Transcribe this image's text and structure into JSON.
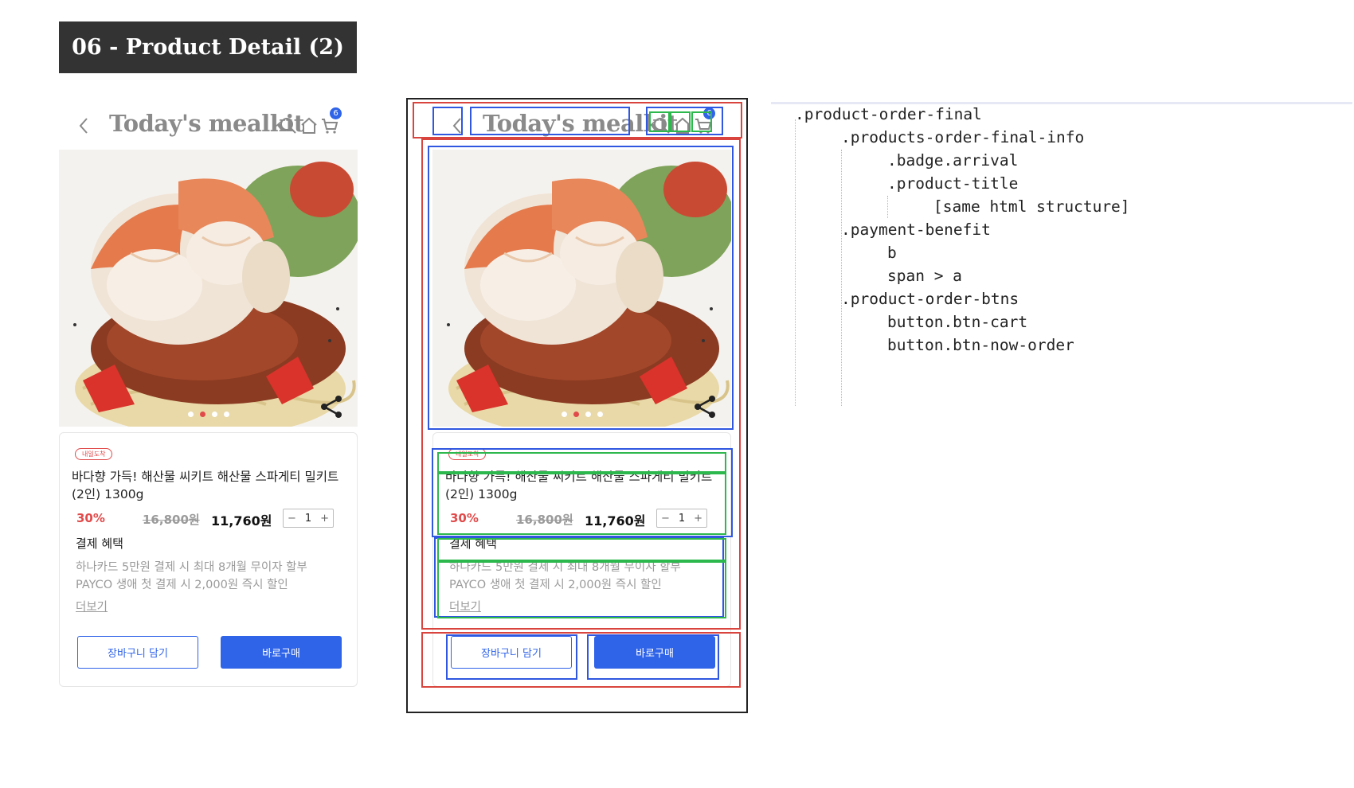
{
  "slide_title": "06 - Product Detail (2)",
  "header": {
    "brand": "Today's mealkit",
    "cart_count": "6"
  },
  "icons": {
    "back": "chevron-left-icon",
    "search": "search-icon",
    "home": "home-icon",
    "cart": "cart-icon",
    "share": "share-icon"
  },
  "carousel": {
    "slides": 4,
    "active": 1
  },
  "product": {
    "badge": "내일도착",
    "title": "바다향 가득! 해산물 씨키트 해산물 스파게티 밀키트 (2인) 1300g",
    "discount": "30%",
    "original_price": "16,800원",
    "sale_price": "11,760원",
    "qty_minus": "−",
    "quantity": "1",
    "qty_plus": "+"
  },
  "benefit": {
    "title": "결제 혜택",
    "line1": "하나카드 5만원 결제 시 최대 8개월 무이자 할부",
    "line2": "PAYCO 생애 첫 결제 시 2,000원 즉시 할인",
    "more": "더보기"
  },
  "buttons": {
    "cart": "장바구니 담기",
    "order": "바로구매"
  },
  "code_tree": [
    ".product-order-final",
    ".products-order-final-info",
    ".badge.arrival",
    ".product-title",
    "[same html structure]",
    ".payment-benefit",
    "b",
    "span > a",
    ".product-order-btns",
    "button.btn-cart",
    "button.btn-now-order"
  ],
  "colors": {
    "accent_blue": "#2f63e8",
    "discount_red": "#e14a4a",
    "annotation_red": "#d9453e",
    "annotation_blue": "#2f57e0",
    "annotation_green": "#2db84d"
  }
}
